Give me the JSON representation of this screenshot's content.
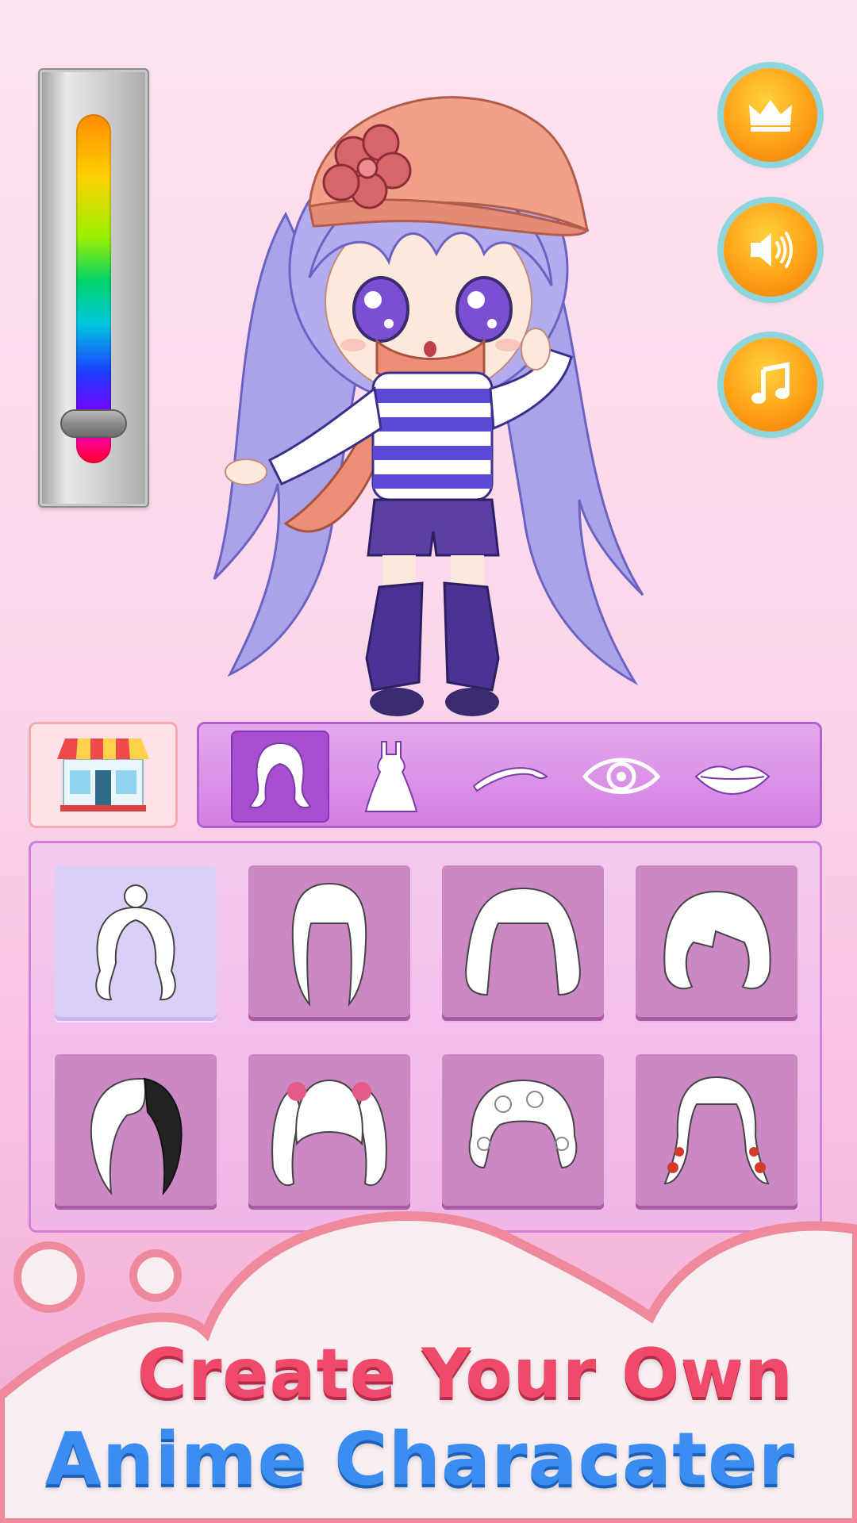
{
  "color_slider": {
    "colors": [
      "#ff8a00",
      "#ffd000",
      "#9cf000",
      "#00d26a",
      "#00c8e0",
      "#1d3cff",
      "#7a00ff",
      "#ff008c",
      "#ff0030"
    ]
  },
  "side_buttons": [
    {
      "name": "premium",
      "icon": "crown-icon"
    },
    {
      "name": "sound",
      "icon": "speaker-icon"
    },
    {
      "name": "music",
      "icon": "music-note-icon"
    }
  ],
  "category_tabs": [
    {
      "name": "hair",
      "icon": "hair-icon",
      "active": true
    },
    {
      "name": "dress",
      "icon": "dress-icon",
      "active": false
    },
    {
      "name": "eyebrows",
      "icon": "eyebrow-icon",
      "active": false
    },
    {
      "name": "eyes",
      "icon": "eye-icon",
      "active": false
    },
    {
      "name": "lips",
      "icon": "lips-icon",
      "active": false
    }
  ],
  "hair_options": [
    {
      "style": "bun-curls",
      "selected": true
    },
    {
      "style": "long-straight",
      "selected": false
    },
    {
      "style": "bob-bangs",
      "selected": false
    },
    {
      "style": "short-bob",
      "selected": false
    },
    {
      "style": "two-tone-side",
      "selected": false
    },
    {
      "style": "twin-tails-bows",
      "selected": false
    },
    {
      "style": "curly-short",
      "selected": false
    },
    {
      "style": "braids-beads",
      "selected": false
    }
  ],
  "banner": {
    "line1": "Create Your Own",
    "line2": "Anime Characater"
  },
  "theme": {
    "accent_pink": "#ef4a6a",
    "accent_blue": "#3c8df2",
    "tab_purple": "#a84ed1"
  }
}
